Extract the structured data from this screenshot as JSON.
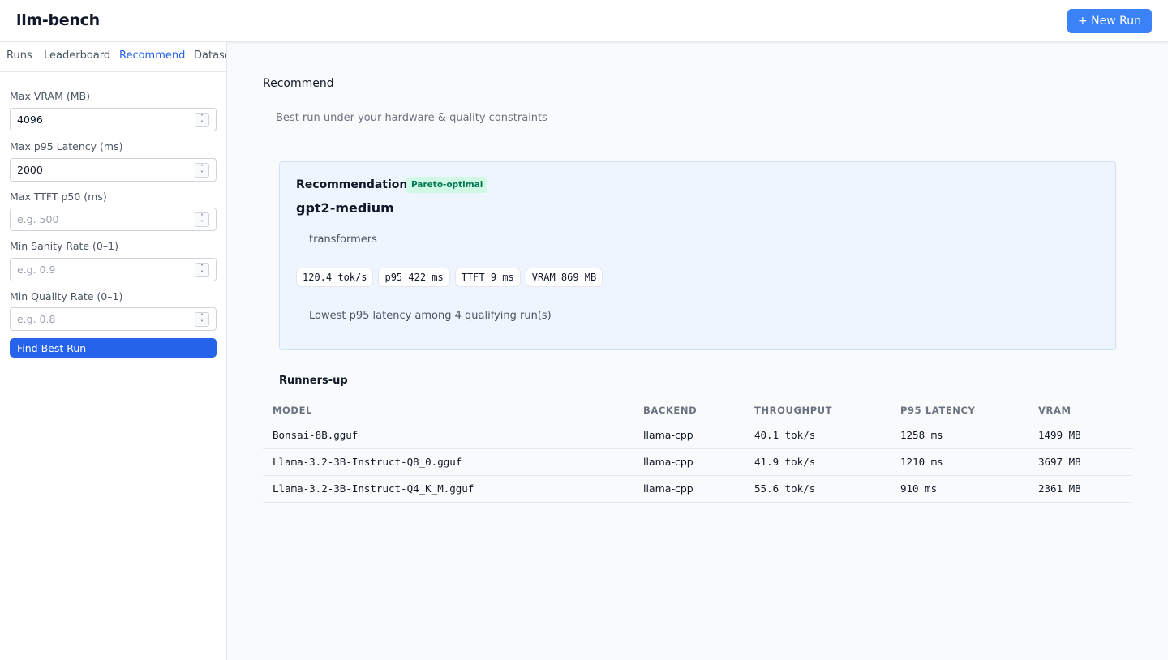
{
  "app": {
    "title": "llm-bench",
    "new_run_label": "+ New Run"
  },
  "tabs": [
    {
      "label": "Runs"
    },
    {
      "label": "Leaderboard"
    },
    {
      "label": "Recommend"
    },
    {
      "label": "Datase"
    }
  ],
  "active_tab": "Recommend",
  "form": {
    "fields": [
      {
        "label": "Max VRAM (MB)",
        "value": "4096",
        "placeholder": ""
      },
      {
        "label": "Max p95 Latency (ms)",
        "value": "2000",
        "placeholder": ""
      },
      {
        "label": "Max TTFT p50 (ms)",
        "value": "",
        "placeholder": "e.g. 500"
      },
      {
        "label": "Min Sanity Rate (0–1)",
        "value": "",
        "placeholder": "e.g. 0.9"
      },
      {
        "label": "Min Quality Rate (0–1)",
        "value": "",
        "placeholder": "e.g. 0.8"
      }
    ],
    "submit_label": "Find Best Run"
  },
  "main": {
    "title": "Recommend",
    "subtitle": "Best run under your hardware & quality constraints"
  },
  "recommendation": {
    "heading": "Recommendation",
    "badge": "Pareto-optimal",
    "model": "gpt2-medium",
    "backend": "transformers",
    "chips": [
      "120.4 tok/s",
      "p95 422 ms",
      "TTFT 9 ms",
      "VRAM 869 MB"
    ],
    "reason": "Lowest p95 latency among 4 qualifying run(s)"
  },
  "runners_up": {
    "title": "Runners-up",
    "columns": [
      "MODEL",
      "BACKEND",
      "THROUGHPUT",
      "P95 LATENCY",
      "VRAM"
    ],
    "rows": [
      {
        "model": "Bonsai-8B.gguf",
        "backend": "llama-cpp",
        "throughput": "40.1 tok/s",
        "p95": "1258 ms",
        "vram": "1499 MB"
      },
      {
        "model": "Llama-3.2-3B-Instruct-Q8_0.gguf",
        "backend": "llama-cpp",
        "throughput": "41.9 tok/s",
        "p95": "1210 ms",
        "vram": "3697 MB"
      },
      {
        "model": "Llama-3.2-3B-Instruct-Q4_K_M.gguf",
        "backend": "llama-cpp",
        "throughput": "55.6 tok/s",
        "p95": "910 ms",
        "vram": "2361 MB"
      }
    ]
  },
  "colors": {
    "accent": "#2563eb",
    "badge_bg": "#d1fae5",
    "badge_text": "#047857",
    "card_bg": "#eef5fe"
  }
}
